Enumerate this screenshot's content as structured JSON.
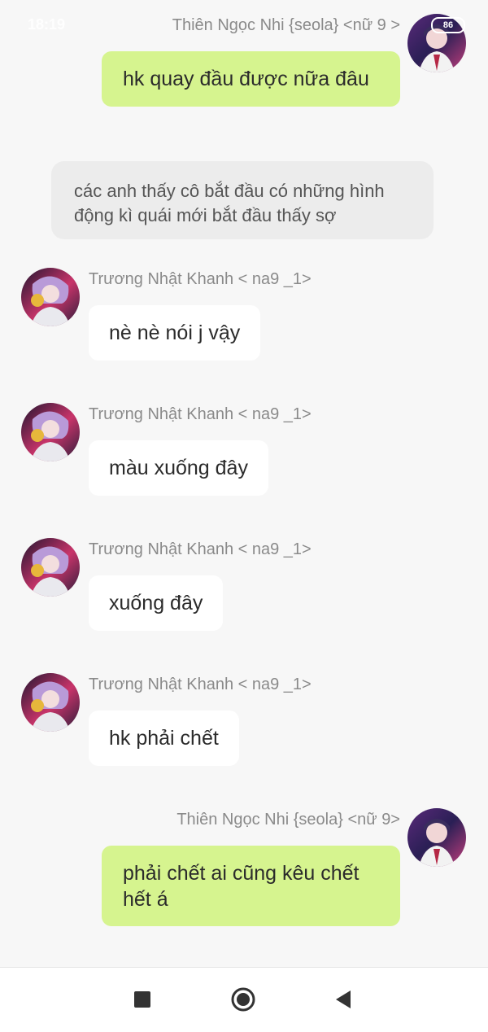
{
  "status_bar": {
    "time": "18:19",
    "battery": "86"
  },
  "messages": [
    {
      "sender": "Thiên Ngọc Nhi {seola} <nữ 9 >",
      "text": "hk quay đầu được nữa đâu",
      "side": "right"
    },
    {
      "narration": "các anh thấy cô bắt đầu có những hình động kì quái mới bắt đầu thấy sợ"
    },
    {
      "sender": "Trương Nhật Khanh < na9 _1>",
      "text": "nè nè nói j vậy",
      "side": "left"
    },
    {
      "sender": "Trương Nhật Khanh < na9 _1>",
      "text": "màu xuống đây",
      "side": "left"
    },
    {
      "sender": "Trương Nhật Khanh < na9 _1>",
      "text": "xuống đây",
      "side": "left"
    },
    {
      "sender": "Trương Nhật Khanh < na9 _1>",
      "text": "hk phải chết",
      "side": "left"
    },
    {
      "sender": "Thiên Ngọc Nhi {seola} <nữ 9>",
      "text": "phải chết ai cũng kêu chết hết á",
      "side": "right"
    }
  ],
  "navbar": {
    "icons": [
      "recent-apps-icon",
      "home-icon",
      "back-icon"
    ]
  },
  "colors": {
    "background": "#f7f7f7",
    "my_bubble": "#d6f48f",
    "other_bubble": "#ffffff",
    "narration_bg": "#ececec",
    "name_text": "#8a8a8a"
  }
}
